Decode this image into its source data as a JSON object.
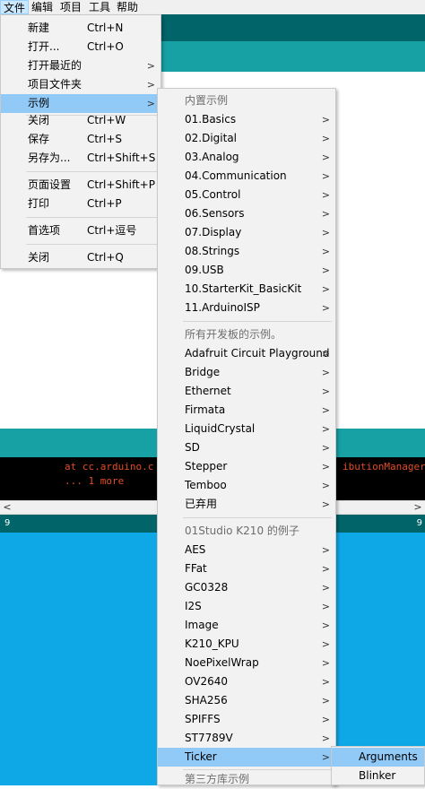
{
  "menubar": {
    "items": [
      "文件",
      "编辑",
      "项目",
      "工具",
      "帮助"
    ]
  },
  "console": {
    "line1": "at cc.arduino.c",
    "line1_right": "ibutionManagerUI",
    "line2": "... 1 more"
  },
  "linebar": {
    "left": "9",
    "right": "9"
  },
  "file_menu": {
    "items": [
      {
        "label": "新建",
        "shortcut": "Ctrl+N"
      },
      {
        "label": "打开...",
        "shortcut": "Ctrl+O"
      },
      {
        "label": "打开最近的",
        "shortcut": ""
      },
      {
        "label": "项目文件夹",
        "shortcut": ""
      },
      {
        "label": "示例",
        "shortcut": ""
      },
      {
        "label": "关闭",
        "shortcut": "Ctrl+W"
      },
      {
        "label": "保存",
        "shortcut": "Ctrl+S"
      },
      {
        "label": "另存为...",
        "shortcut": "Ctrl+Shift+S"
      },
      {
        "label": "页面设置",
        "shortcut": "Ctrl+Shift+P"
      },
      {
        "label": "打印",
        "shortcut": "Ctrl+P"
      },
      {
        "label": "首选项",
        "shortcut": "Ctrl+逗号"
      },
      {
        "label": "关闭",
        "shortcut": "Ctrl+Q"
      }
    ]
  },
  "examples_menu": {
    "builtin_header": "内置示例",
    "builtin": [
      "01.Basics",
      "02.Digital",
      "03.Analog",
      "04.Communication",
      "05.Control",
      "06.Sensors",
      "07.Display",
      "08.Strings",
      "09.USB",
      "10.StarterKit_BasicKit",
      "11.ArduinoISP"
    ],
    "allboards_header": "所有开发板的示例。",
    "allboards": [
      "Adafruit Circuit Playground",
      "Bridge",
      "Ethernet",
      "Firmata",
      "LiquidCrystal",
      "SD",
      "Stepper",
      "Temboo",
      "已弃用"
    ],
    "board_header": "01Studio K210 的例子",
    "board": [
      "AES",
      "FFat",
      "GC0328",
      "I2S",
      "Image",
      "K210_KPU",
      "NoePixelWrap",
      "OV2640",
      "SHA256",
      "SPIFFS",
      "ST7789V",
      "Ticker"
    ],
    "thirdparty_header": "第三方库示例"
  },
  "ticker_menu": {
    "items": [
      "Arguments",
      "Blinker"
    ]
  },
  "colors": {
    "toolbar": "#006468",
    "tabbar": "#17a1a5",
    "highlight": "#91c9f7",
    "console_text": "#e34c26"
  }
}
